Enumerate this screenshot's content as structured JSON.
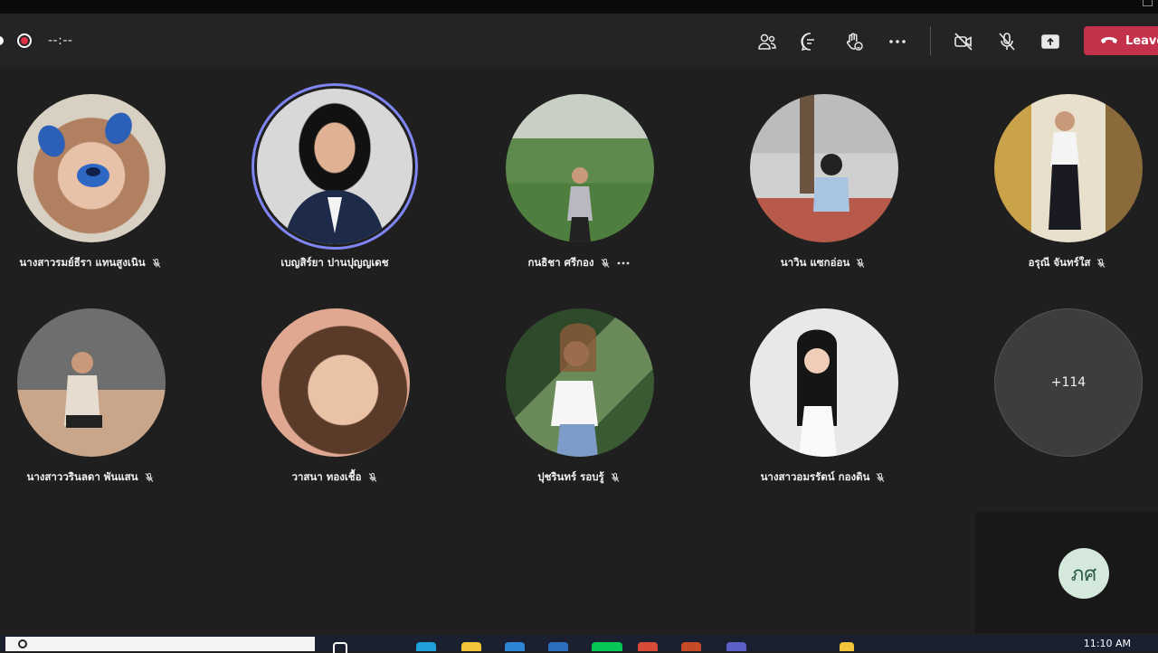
{
  "toolbar": {
    "timer": "--:--",
    "leave_label": "Leave",
    "colors": {
      "leave": "#c4314b",
      "record": "#e0334a",
      "speaking_ring": "#7f85f5"
    }
  },
  "participants": [
    {
      "name": "นางสาวรมย์ธีรา แทนสูงเนิน",
      "muted": true
    },
    {
      "name": "เบญสิร์ยา ปานปุญญเดช",
      "muted": false,
      "speaking": true
    },
    {
      "name": "กนธิชา ศรีกอง",
      "muted": true,
      "more": true
    },
    {
      "name": "นาวิน แซกอ่อน",
      "muted": true
    },
    {
      "name": "อรุณี จันทร์ใส",
      "muted": true
    },
    {
      "name": "นางสาววรินลดา พันแสน",
      "muted": true
    },
    {
      "name": "วาสนา ทองเชื้อ",
      "muted": true
    },
    {
      "name": "ปุชรินทร์ รอบรู้",
      "muted": true
    },
    {
      "name": "นางสาวอมรรัตน์ กองดิน",
      "muted": true
    }
  ],
  "overflow_count": "+114",
  "self": {
    "initials": "ภศ"
  },
  "taskbar": {
    "time": "11:10 AM"
  }
}
